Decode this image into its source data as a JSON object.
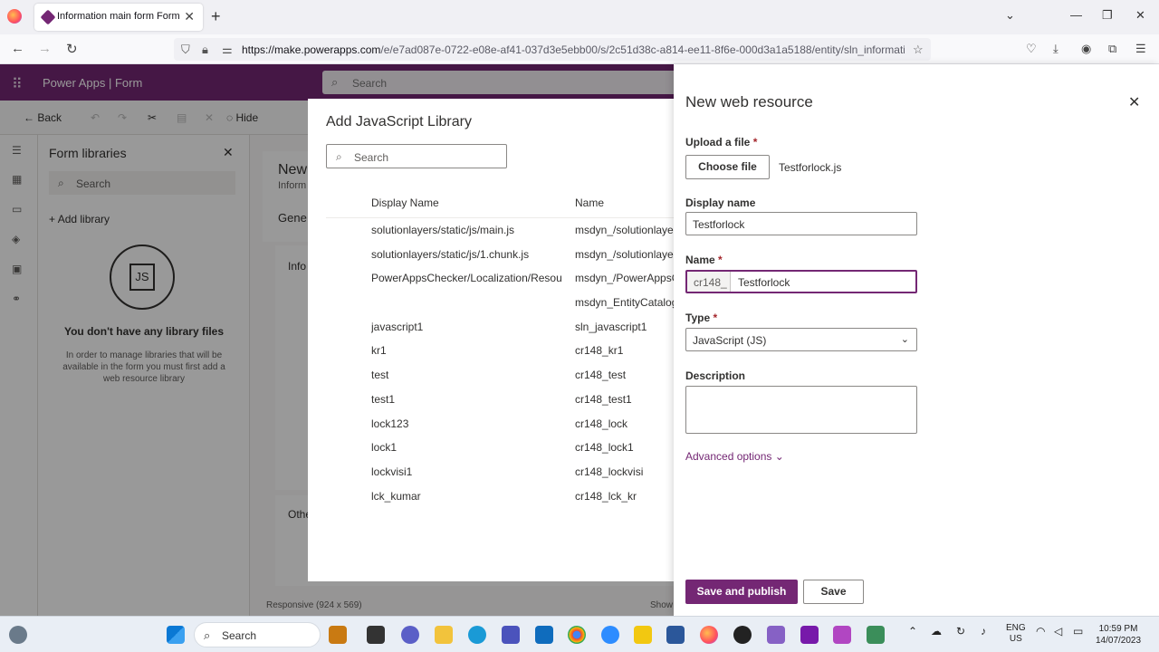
{
  "browser": {
    "tab_title": "Information main form Form",
    "url_host": "https://make.powerapps.com",
    "url_path": "/e/e7ad087e-0722-e08e-af41-037d3e5ebb00/s/2c51d38c-a814-ee11-8f6e-000d3a1a5188/entity/sln_information/fo"
  },
  "app": {
    "brand": "Power Apps | Form",
    "search_placeholder": "Search",
    "commands": {
      "back": "Back",
      "hide": "Hide"
    },
    "libraries_panel": {
      "title": "Form libraries",
      "search_placeholder": "Search",
      "add_library": "Add library",
      "empty_title": "You don't have any library files",
      "empty_desc": "In order to manage libraries that will be available in the form you must first add a web resource library"
    },
    "canvas": {
      "header": "New",
      "sub": "Inform",
      "tab": "Gene",
      "section": "Info",
      "other": "Othe",
      "footer": "Responsive (924 x 569)",
      "show": "Show"
    }
  },
  "dialog": {
    "title": "Add JavaScript Library",
    "search_placeholder": "Search",
    "columns": [
      "Display Name",
      "Name"
    ],
    "rows": [
      {
        "display": "solutionlayers/static/js/main.js",
        "name": "msdyn_/solutionlayers"
      },
      {
        "display": "solutionlayers/static/js/1.chunk.js",
        "name": "msdyn_/solutionlayers"
      },
      {
        "display": "PowerAppsChecker/Localization/Resou...",
        "name": "msdyn_/PowerAppsChecker"
      },
      {
        "display": "",
        "name": "msdyn_EntityCatalog"
      },
      {
        "display": "javascript1",
        "name": "sln_javascript1"
      },
      {
        "display": "kr1",
        "name": "cr148_kr1"
      },
      {
        "display": "test",
        "name": "cr148_test"
      },
      {
        "display": "test1",
        "name": "cr148_test1"
      },
      {
        "display": "lock123",
        "name": "cr148_lock"
      },
      {
        "display": "lock1",
        "name": "cr148_lock1"
      },
      {
        "display": "lockvisi1",
        "name": "cr148_lockvisi"
      },
      {
        "display": "lck_kumar",
        "name": "cr148_lck_kr"
      }
    ]
  },
  "panel": {
    "title": "New web resource",
    "upload_label": "Upload a file",
    "choose_file": "Choose file",
    "file_name": "Testforlock.js",
    "display_name_label": "Display name",
    "display_name_value": "Testforlock",
    "name_label": "Name",
    "name_prefix": "cr148_",
    "name_value": "Testforlock",
    "type_label": "Type",
    "type_value": "JavaScript (JS)",
    "description_label": "Description",
    "advanced_options": "Advanced options",
    "save_publish": "Save and publish",
    "save": "Save",
    "required_mark": "*"
  },
  "taskbar": {
    "search": "Search",
    "lang1": "ENG",
    "lang2": "US",
    "time": "10:59 PM",
    "date": "14/07/2023"
  },
  "colors": {
    "brand": "#742774",
    "overlay": "rgba(0,0,0,0.4)"
  }
}
